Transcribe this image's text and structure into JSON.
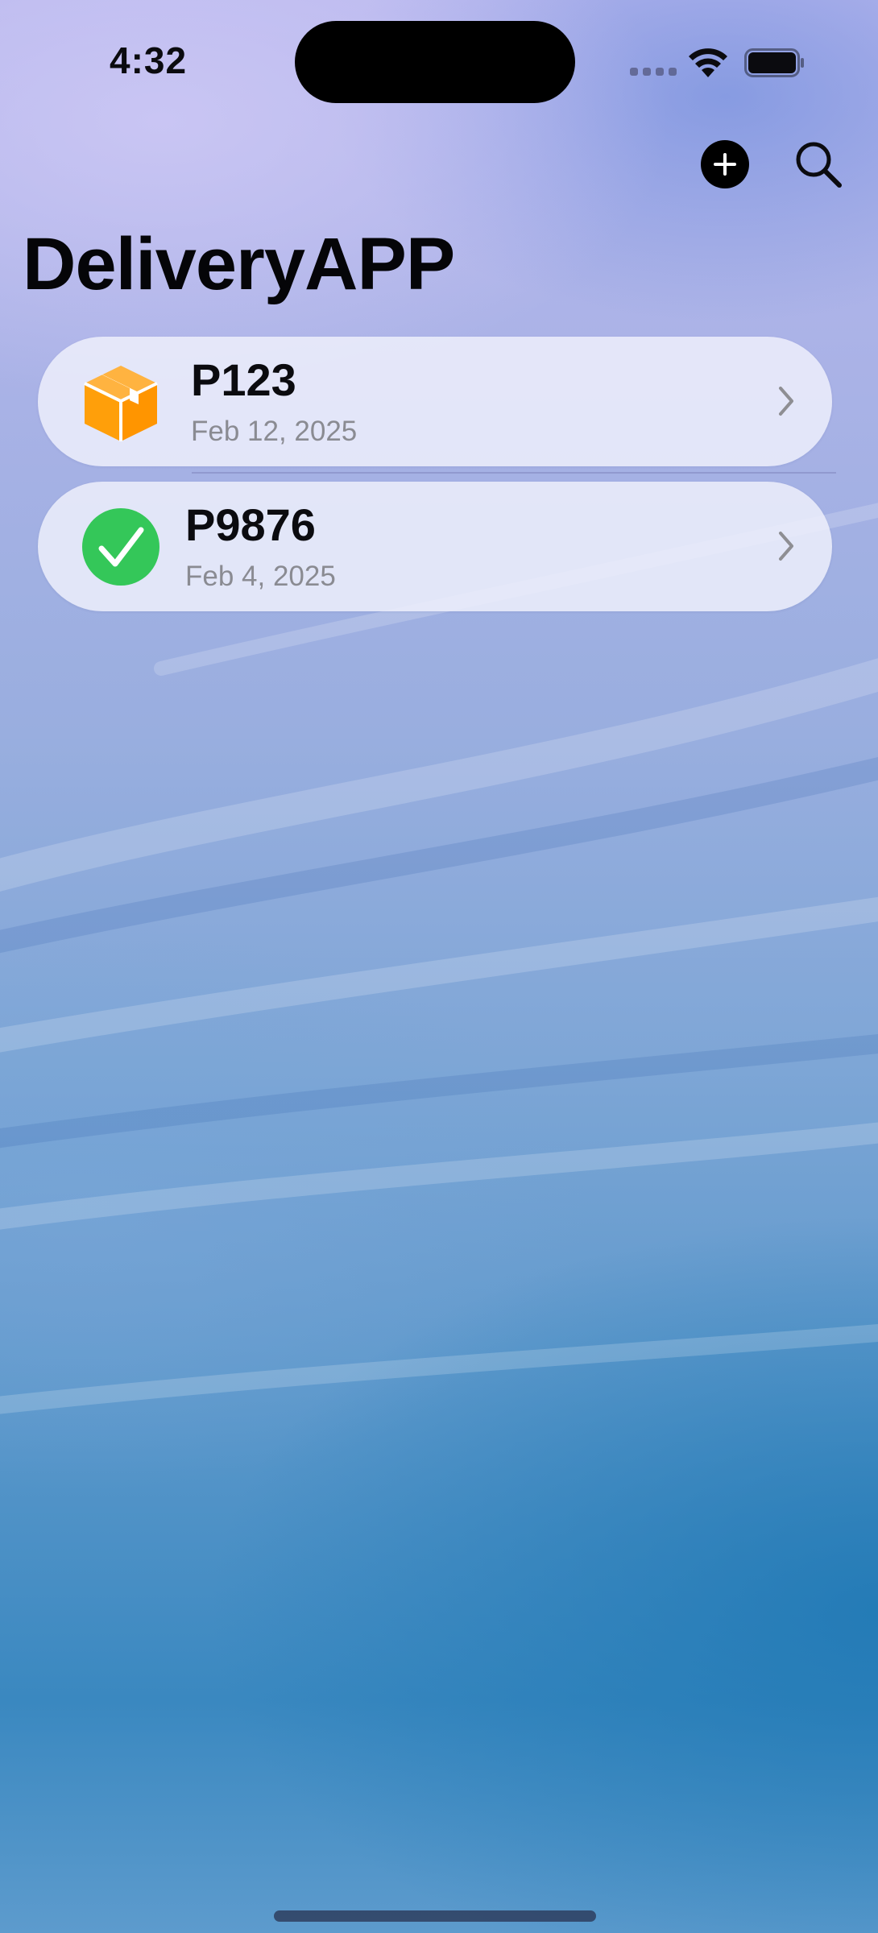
{
  "status_bar": {
    "time": "4:32"
  },
  "nav": {
    "add_icon": "plus-circle-icon",
    "search_icon": "magnifying-glass-icon",
    "title": "DeliveryAPP"
  },
  "packages": [
    {
      "id": "P123",
      "date": "Feb 12, 2025",
      "icon": "package-box-icon",
      "status_color": "#FF9F0A"
    },
    {
      "id": "P9876",
      "date": "Feb 4, 2025",
      "icon": "checkmark-circle-icon",
      "status_color": "#34C759"
    }
  ],
  "colors": {
    "accent": "#000000",
    "delivered": "#34C759",
    "in_transit": "#FF9F0A"
  }
}
